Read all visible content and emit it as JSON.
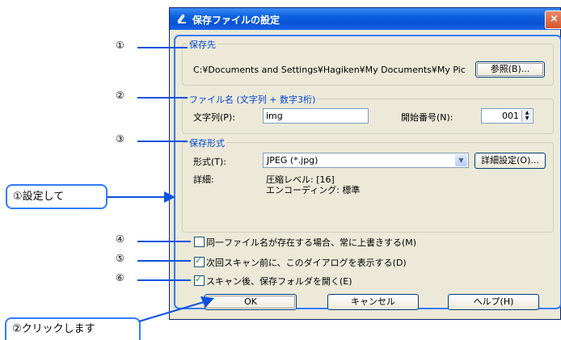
{
  "dialog": {
    "title": "保存ファイルの設定",
    "close_glyph": "×"
  },
  "save_dest": {
    "legend": "保存先",
    "path": "C:¥Documents and Settings¥Hagiken¥My Documents¥My Pic",
    "browse_label": "参照(B)..."
  },
  "filename": {
    "legend": "ファイル名 (文字列 + 数字3桁)",
    "prefix_label": "文字列(P):",
    "prefix_value": "img",
    "start_label": "開始番号(N):",
    "start_value": "001"
  },
  "format": {
    "legend": "保存形式",
    "type_label": "形式(T):",
    "type_value": "JPEG (*.jpg)",
    "detail_btn": "詳細設定(O)...",
    "details_label": "詳細:",
    "details_line1": "圧縮レベル: [16]",
    "details_line2": "エンコーディング: 標準"
  },
  "options": [
    {
      "label": "同一ファイル名が存在する場合、常に上書きする(M)",
      "checked": false
    },
    {
      "label": "次回スキャン前に、このダイアログを表示する(D)",
      "checked": true
    },
    {
      "label": "スキャン後、保存フォルダを開く(E)",
      "checked": true
    }
  ],
  "buttons": {
    "ok": "OK",
    "cancel": "キャンセル",
    "help": "ヘルプ(H)"
  },
  "annotations": {
    "n1": "①",
    "n2": "②",
    "n3": "③",
    "n4": "④",
    "n5": "⑤",
    "n6": "⑥",
    "callout1": "①設定して",
    "callout2": "②クリックします"
  },
  "colors": {
    "accent": "#2f7dff",
    "legend": "#0046d5",
    "dialog_bg": "#ece9d8"
  }
}
